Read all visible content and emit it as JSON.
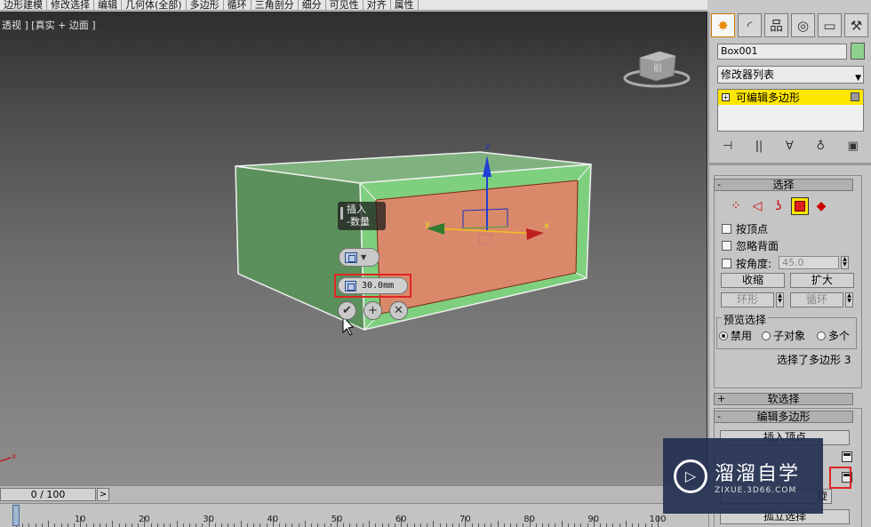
{
  "ribbon": {
    "tabs": [
      "边形建模",
      "修改选择",
      "编辑",
      "几何体(全部)",
      "多边形",
      "循环",
      "三角剖分",
      "细分",
      "可见性",
      "对齐",
      "属性"
    ]
  },
  "viewport": {
    "label": "透视 ] [真实 + 边面 ]",
    "gizmo_axis_z": "z",
    "gizmo_axis_x": "x",
    "gizmo_axis_y": "y",
    "corner_axis_x": "x",
    "viewcube_text": "前"
  },
  "caddy": {
    "title_line1": "插入",
    "title_line2": "-数量",
    "value": "30.0mm",
    "ok_icon": "✔",
    "apply_icon": "+",
    "cancel_icon": "✕"
  },
  "timeline": {
    "frame_display": "0 / 100",
    "next_label": ">",
    "ticks": [
      "0",
      "10",
      "20",
      "30",
      "40",
      "50",
      "60",
      "70",
      "80",
      "90",
      "100"
    ]
  },
  "panel": {
    "tabs": [
      "create-icon",
      "modify-icon",
      "hierarchy-icon",
      "motion-icon",
      "display-icon",
      "utilities-icon"
    ],
    "object_name": "Box001",
    "object_color": "#8fd08f",
    "modifier_list": "修改器列表",
    "stack_item": "可编辑多边形",
    "selection": {
      "header": "选择",
      "by_vertex": "按顶点",
      "ignore_backfacing": "忽略背面",
      "by_angle": "按角度:",
      "angle_value": "45.0",
      "shrink": "收缩",
      "grow": "扩大",
      "ring": "环形",
      "loop": "循环",
      "preview_label": "预览选择",
      "preview_disabled": "禁用",
      "preview_subobject": "子对象",
      "preview_multi": "多个",
      "status": "选择了多边形 3"
    },
    "soft_selection": "软选择",
    "edit_polygons": "编辑多边形",
    "insert_vertex": "插入顶点",
    "partial_text": "旋",
    "partial_text2": "孤立选择"
  },
  "watermark": {
    "title": "溜溜自学",
    "url": "ZIXUE.3D66.COM"
  }
}
